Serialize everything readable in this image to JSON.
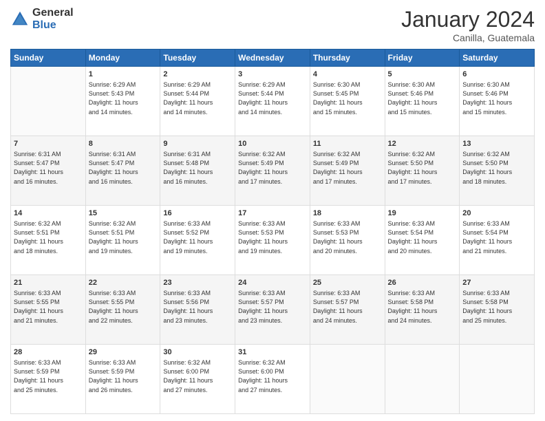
{
  "logo": {
    "general": "General",
    "blue": "Blue"
  },
  "title": "January 2024",
  "location": "Canilla, Guatemala",
  "days": [
    "Sunday",
    "Monday",
    "Tuesday",
    "Wednesday",
    "Thursday",
    "Friday",
    "Saturday"
  ],
  "weeks": [
    [
      {
        "num": "",
        "lines": []
      },
      {
        "num": "1",
        "lines": [
          "Sunrise: 6:29 AM",
          "Sunset: 5:43 PM",
          "Daylight: 11 hours",
          "and 14 minutes."
        ]
      },
      {
        "num": "2",
        "lines": [
          "Sunrise: 6:29 AM",
          "Sunset: 5:44 PM",
          "Daylight: 11 hours",
          "and 14 minutes."
        ]
      },
      {
        "num": "3",
        "lines": [
          "Sunrise: 6:29 AM",
          "Sunset: 5:44 PM",
          "Daylight: 11 hours",
          "and 14 minutes."
        ]
      },
      {
        "num": "4",
        "lines": [
          "Sunrise: 6:30 AM",
          "Sunset: 5:45 PM",
          "Daylight: 11 hours",
          "and 15 minutes."
        ]
      },
      {
        "num": "5",
        "lines": [
          "Sunrise: 6:30 AM",
          "Sunset: 5:46 PM",
          "Daylight: 11 hours",
          "and 15 minutes."
        ]
      },
      {
        "num": "6",
        "lines": [
          "Sunrise: 6:30 AM",
          "Sunset: 5:46 PM",
          "Daylight: 11 hours",
          "and 15 minutes."
        ]
      }
    ],
    [
      {
        "num": "7",
        "lines": [
          "Sunrise: 6:31 AM",
          "Sunset: 5:47 PM",
          "Daylight: 11 hours",
          "and 16 minutes."
        ]
      },
      {
        "num": "8",
        "lines": [
          "Sunrise: 6:31 AM",
          "Sunset: 5:47 PM",
          "Daylight: 11 hours",
          "and 16 minutes."
        ]
      },
      {
        "num": "9",
        "lines": [
          "Sunrise: 6:31 AM",
          "Sunset: 5:48 PM",
          "Daylight: 11 hours",
          "and 16 minutes."
        ]
      },
      {
        "num": "10",
        "lines": [
          "Sunrise: 6:32 AM",
          "Sunset: 5:49 PM",
          "Daylight: 11 hours",
          "and 17 minutes."
        ]
      },
      {
        "num": "11",
        "lines": [
          "Sunrise: 6:32 AM",
          "Sunset: 5:49 PM",
          "Daylight: 11 hours",
          "and 17 minutes."
        ]
      },
      {
        "num": "12",
        "lines": [
          "Sunrise: 6:32 AM",
          "Sunset: 5:50 PM",
          "Daylight: 11 hours",
          "and 17 minutes."
        ]
      },
      {
        "num": "13",
        "lines": [
          "Sunrise: 6:32 AM",
          "Sunset: 5:50 PM",
          "Daylight: 11 hours",
          "and 18 minutes."
        ]
      }
    ],
    [
      {
        "num": "14",
        "lines": [
          "Sunrise: 6:32 AM",
          "Sunset: 5:51 PM",
          "Daylight: 11 hours",
          "and 18 minutes."
        ]
      },
      {
        "num": "15",
        "lines": [
          "Sunrise: 6:32 AM",
          "Sunset: 5:51 PM",
          "Daylight: 11 hours",
          "and 19 minutes."
        ]
      },
      {
        "num": "16",
        "lines": [
          "Sunrise: 6:33 AM",
          "Sunset: 5:52 PM",
          "Daylight: 11 hours",
          "and 19 minutes."
        ]
      },
      {
        "num": "17",
        "lines": [
          "Sunrise: 6:33 AM",
          "Sunset: 5:53 PM",
          "Daylight: 11 hours",
          "and 19 minutes."
        ]
      },
      {
        "num": "18",
        "lines": [
          "Sunrise: 6:33 AM",
          "Sunset: 5:53 PM",
          "Daylight: 11 hours",
          "and 20 minutes."
        ]
      },
      {
        "num": "19",
        "lines": [
          "Sunrise: 6:33 AM",
          "Sunset: 5:54 PM",
          "Daylight: 11 hours",
          "and 20 minutes."
        ]
      },
      {
        "num": "20",
        "lines": [
          "Sunrise: 6:33 AM",
          "Sunset: 5:54 PM",
          "Daylight: 11 hours",
          "and 21 minutes."
        ]
      }
    ],
    [
      {
        "num": "21",
        "lines": [
          "Sunrise: 6:33 AM",
          "Sunset: 5:55 PM",
          "Daylight: 11 hours",
          "and 21 minutes."
        ]
      },
      {
        "num": "22",
        "lines": [
          "Sunrise: 6:33 AM",
          "Sunset: 5:55 PM",
          "Daylight: 11 hours",
          "and 22 minutes."
        ]
      },
      {
        "num": "23",
        "lines": [
          "Sunrise: 6:33 AM",
          "Sunset: 5:56 PM",
          "Daylight: 11 hours",
          "and 23 minutes."
        ]
      },
      {
        "num": "24",
        "lines": [
          "Sunrise: 6:33 AM",
          "Sunset: 5:57 PM",
          "Daylight: 11 hours",
          "and 23 minutes."
        ]
      },
      {
        "num": "25",
        "lines": [
          "Sunrise: 6:33 AM",
          "Sunset: 5:57 PM",
          "Daylight: 11 hours",
          "and 24 minutes."
        ]
      },
      {
        "num": "26",
        "lines": [
          "Sunrise: 6:33 AM",
          "Sunset: 5:58 PM",
          "Daylight: 11 hours",
          "and 24 minutes."
        ]
      },
      {
        "num": "27",
        "lines": [
          "Sunrise: 6:33 AM",
          "Sunset: 5:58 PM",
          "Daylight: 11 hours",
          "and 25 minutes."
        ]
      }
    ],
    [
      {
        "num": "28",
        "lines": [
          "Sunrise: 6:33 AM",
          "Sunset: 5:59 PM",
          "Daylight: 11 hours",
          "and 25 minutes."
        ]
      },
      {
        "num": "29",
        "lines": [
          "Sunrise: 6:33 AM",
          "Sunset: 5:59 PM",
          "Daylight: 11 hours",
          "and 26 minutes."
        ]
      },
      {
        "num": "30",
        "lines": [
          "Sunrise: 6:32 AM",
          "Sunset: 6:00 PM",
          "Daylight: 11 hours",
          "and 27 minutes."
        ]
      },
      {
        "num": "31",
        "lines": [
          "Sunrise: 6:32 AM",
          "Sunset: 6:00 PM",
          "Daylight: 11 hours",
          "and 27 minutes."
        ]
      },
      {
        "num": "",
        "lines": []
      },
      {
        "num": "",
        "lines": []
      },
      {
        "num": "",
        "lines": []
      }
    ]
  ]
}
